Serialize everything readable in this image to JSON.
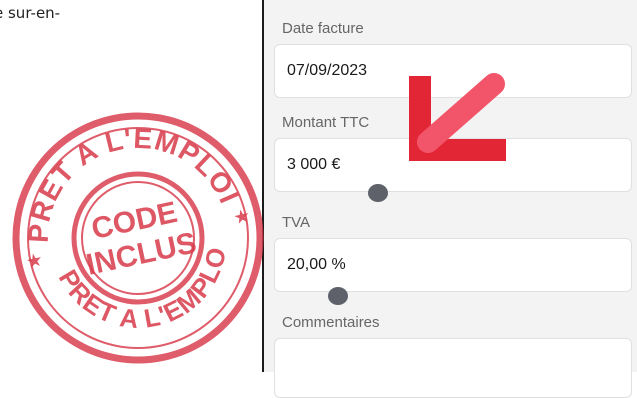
{
  "document": {
    "text": "e sur-en-"
  },
  "form": {
    "date": {
      "label": "Date facture",
      "value": "07/09/2023"
    },
    "amount": {
      "label": "Montant TTC",
      "value": "3 000 €"
    },
    "tva": {
      "label": "TVA",
      "value": "20,00 %"
    },
    "comments": {
      "label": "Commentaires",
      "value": ""
    }
  },
  "stamp": {
    "top_text": "PRET A L'EMPLOI",
    "bottom_text": "PRET A L'EMPLOI",
    "center_line1": "CODE",
    "center_line2": "INCLUS",
    "color": "#d83a4a"
  },
  "arrow": {
    "color": "#e32636",
    "icon": "arrow-down-left-icon"
  }
}
